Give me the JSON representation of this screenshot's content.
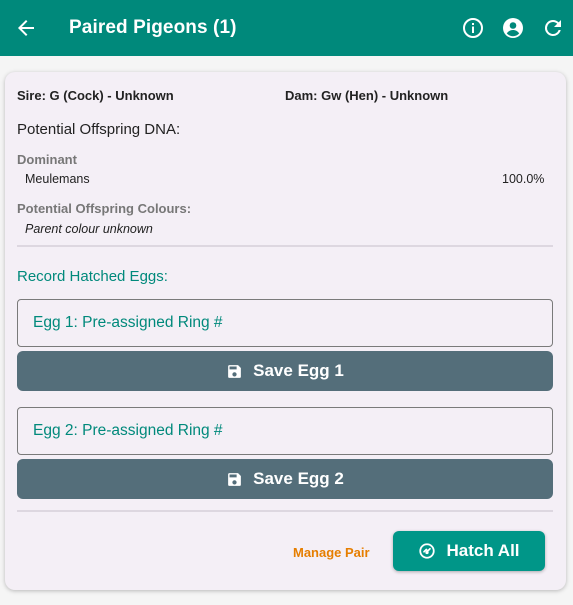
{
  "appbar": {
    "title": "Paired Pigeons (1)",
    "icons": [
      "back-arrow-icon",
      "info-icon",
      "account-circle-icon",
      "refresh-icon"
    ],
    "color": "#00897b"
  },
  "card": {
    "sire": "Sire: G (Cock) - Unknown",
    "dam": "Dam: Gw (Hen) - Unknown",
    "dna_heading": "Potential Offspring DNA:",
    "dominant_label": "Dominant",
    "dominant_name": "Meulemans",
    "dominant_pct": "100.0%",
    "colours_label": "Potential Offspring Colours:",
    "colours_value": "Parent colour unknown",
    "record_heading": "Record Hatched Eggs:",
    "eggs": [
      {
        "placeholder": "Egg 1: Pre-assigned Ring #",
        "save_label": "Save Egg 1"
      },
      {
        "placeholder": "Egg 2: Pre-assigned Ring #",
        "save_label": "Save Egg 2"
      }
    ],
    "manage_label": "Manage Pair",
    "hatch_label": "Hatch All"
  },
  "colors": {
    "accent": "#00897b",
    "save_button": "#546e7a",
    "hatch_button": "#009688",
    "manage_link": "#e67e00"
  }
}
